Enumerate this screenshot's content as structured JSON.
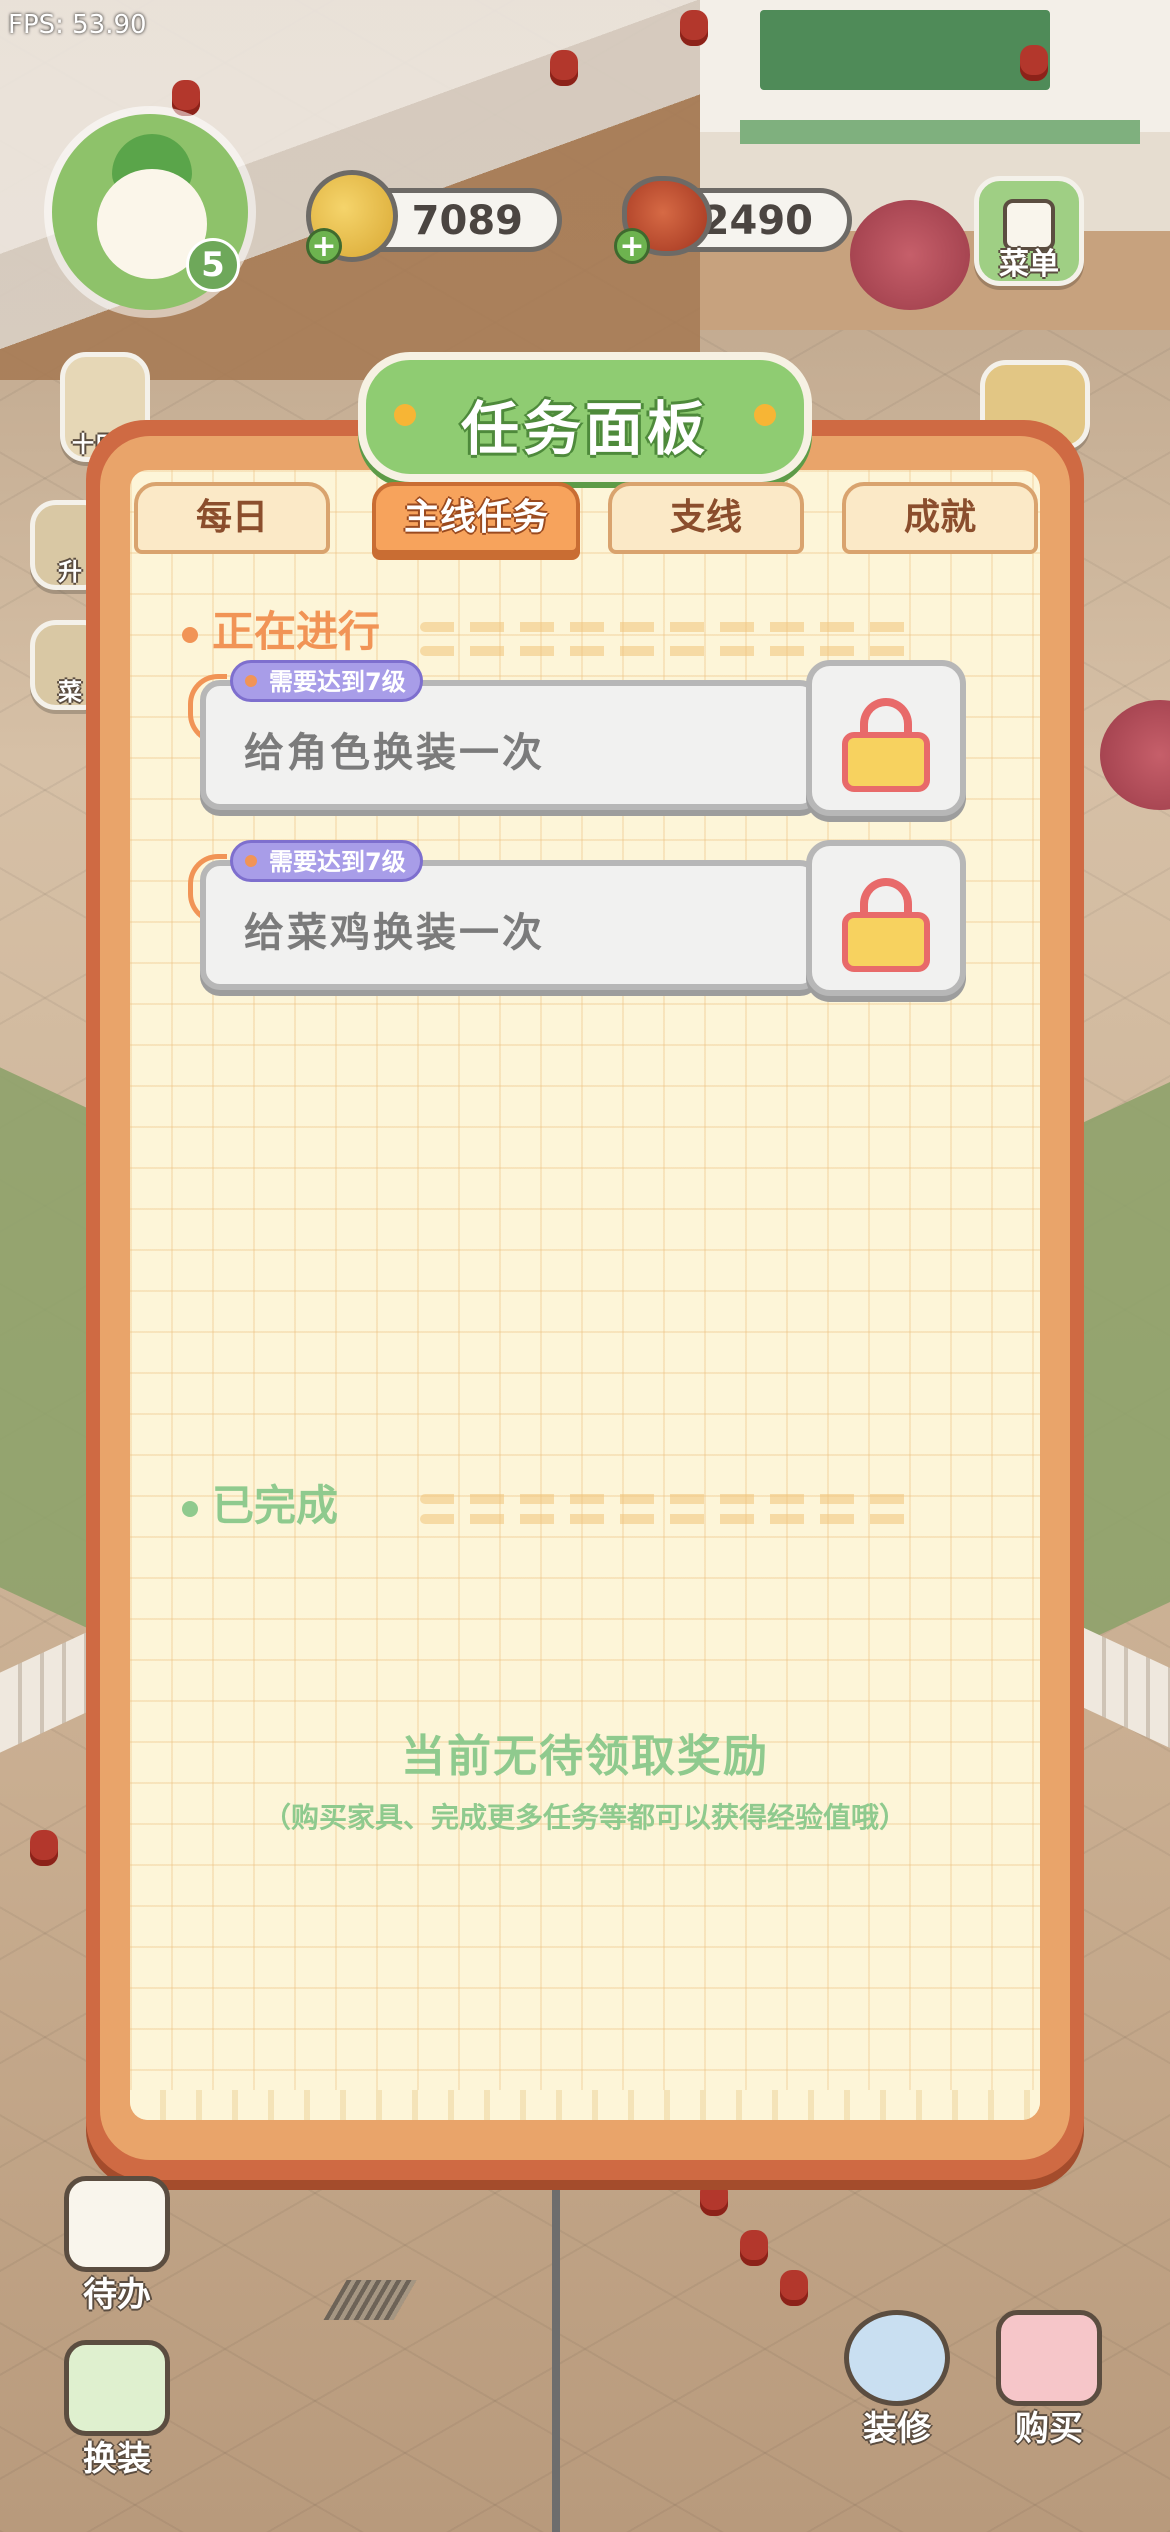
{
  "fps": "FPS: 53.90",
  "hud": {
    "level": "5",
    "coins": "7089",
    "meat": "2490",
    "menu_label": "菜单"
  },
  "panel": {
    "title": "任务面板",
    "tabs": [
      {
        "label": "每日"
      },
      {
        "label": "主线任务"
      },
      {
        "label": "支线"
      },
      {
        "label": "成就"
      }
    ],
    "in_progress_label": "正在进行",
    "tasks": [
      {
        "tag": "需要达到7级",
        "text": "给角色换装一次"
      },
      {
        "tag": "需要达到7级",
        "text": "给菜鸡换装一次"
      }
    ],
    "completed_label": "已完成",
    "empty_title": "当前无待领取奖励",
    "empty_sub": "（购买家具、完成更多任务等都可以获得经验值哦）"
  },
  "left_side": {
    "item1": "十日签",
    "item2": "升",
    "item3": "菜"
  },
  "bottom": {
    "todo": "待办",
    "dress": "换装",
    "decorate": "装修",
    "buy": "购买"
  },
  "colors": {
    "panel_orange": "#cf6a43",
    "title_green": "#8fcc72",
    "active_tab": "#f7a35c",
    "in_progress_orange": "#f19456",
    "completed_green": "#8fca8e",
    "level_tag_purple": "#a89de8",
    "lock_red": "#e86a6a"
  }
}
